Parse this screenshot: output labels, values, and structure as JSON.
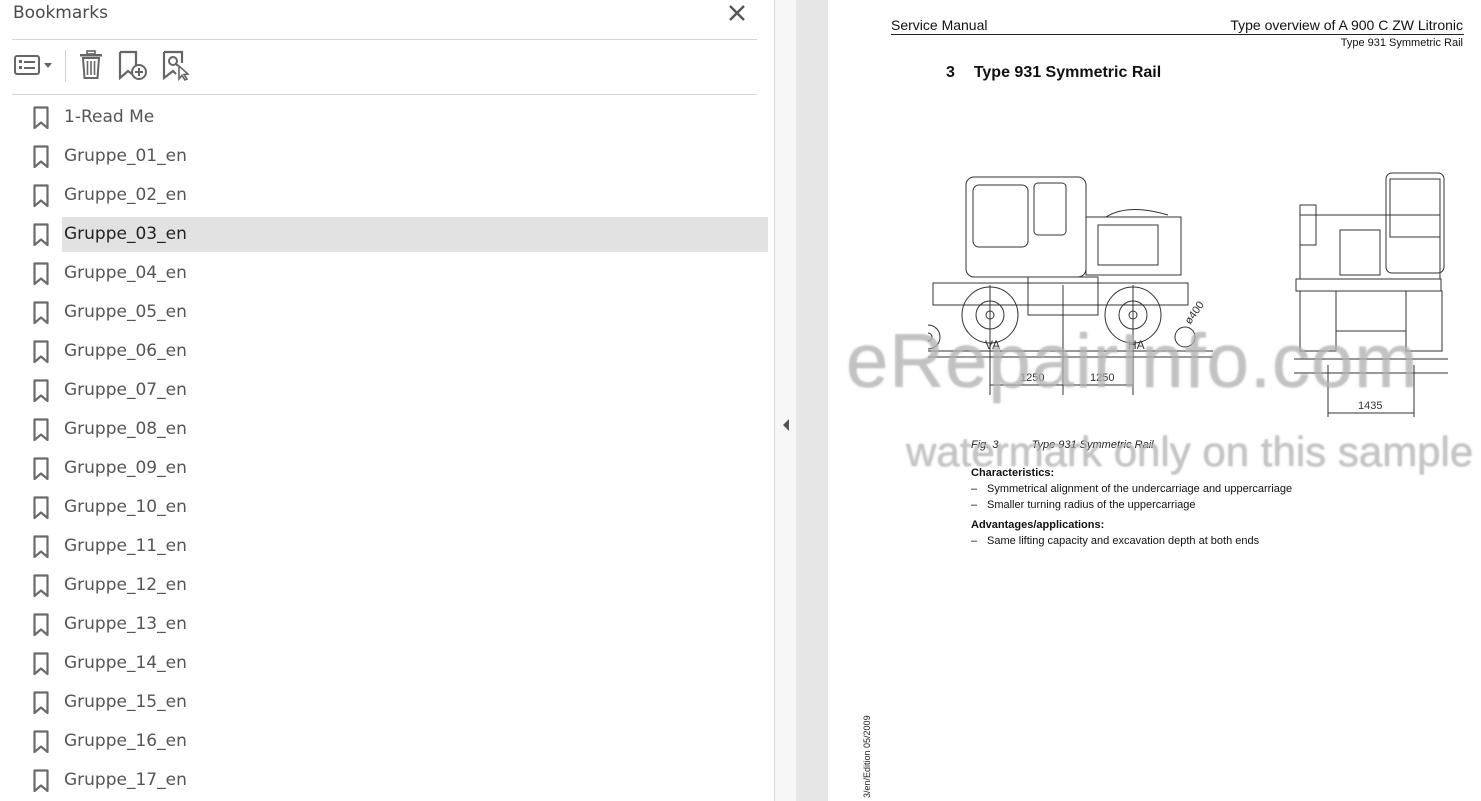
{
  "bookmarks_panel": {
    "title": "Bookmarks",
    "toolbar": {
      "options_icon": "list-options-icon",
      "delete_icon": "trash-icon",
      "new_bookmark_icon": "add-bookmark-icon",
      "find_bookmark_icon": "find-bookmark-icon"
    },
    "items": [
      {
        "label": "1-Read Me"
      },
      {
        "label": "Gruppe_01_en"
      },
      {
        "label": "Gruppe_02_en"
      },
      {
        "label": "Gruppe_03_en",
        "selected": true
      },
      {
        "label": "Gruppe_04_en"
      },
      {
        "label": "Gruppe_05_en"
      },
      {
        "label": "Gruppe_06_en"
      },
      {
        "label": "Gruppe_07_en"
      },
      {
        "label": "Gruppe_08_en"
      },
      {
        "label": "Gruppe_09_en"
      },
      {
        "label": "Gruppe_10_en"
      },
      {
        "label": "Gruppe_11_en"
      },
      {
        "label": "Gruppe_12_en"
      },
      {
        "label": "Gruppe_13_en"
      },
      {
        "label": "Gruppe_14_en"
      },
      {
        "label": "Gruppe_15_en"
      },
      {
        "label": "Gruppe_16_en"
      },
      {
        "label": "Gruppe_17_en"
      }
    ]
  },
  "document": {
    "header_left": "Service Manual",
    "header_right": "Type overview of A 900 C ZW Litronic",
    "header_sub": "Type 931 Symmetric Rail",
    "section_number": "3",
    "section_title": "Type 931 Symmetric Rail",
    "drawing": {
      "dim_diameter": "ø400",
      "label_va": "VA",
      "label_ha": "HA",
      "dim_1": "1250",
      "dim_2": "1250",
      "dim_3": "1435"
    },
    "figure_number": "Fig. 3",
    "figure_caption": "Type 931 Symmetric Rail",
    "characteristics_heading": "Characteristics:",
    "characteristics": [
      "Symmetrical alignment of the undercarriage and uppercarriage",
      "Smaller turning radius of the uppercarriage"
    ],
    "advantages_heading": "Advantages/applications:",
    "advantages": [
      "Same lifting capacity and excavation depth at both ends"
    ],
    "side_note": "3/en/Edition 05/2009",
    "watermark_1": "eRepairInfo.com",
    "watermark_2": "watermark only on this sample"
  },
  "colors": {
    "selected_bg": "#e2e2e2",
    "panel_bg": "#ffffff",
    "gutter_bg": "#e6e6e6",
    "icon_color": "#6b6b6b"
  }
}
